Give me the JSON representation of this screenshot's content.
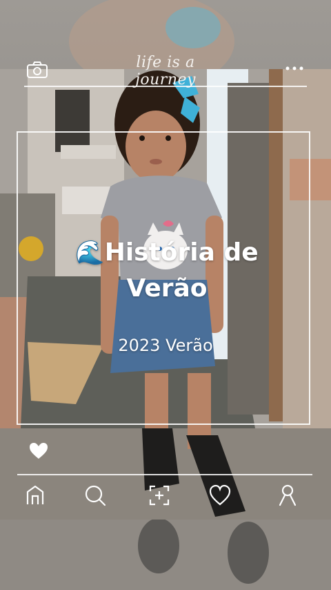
{
  "header": {
    "script_title": "life is a journey",
    "camera_icon": "camera-icon",
    "more_icon": "more-dots-icon"
  },
  "story": {
    "emoji": "🌊",
    "title": "História de Verão",
    "subtitle": "2023 Verão"
  },
  "nav": {
    "items": [
      "home-icon",
      "search-icon",
      "add-photo-icon",
      "heart-outline-icon",
      "profile-icon"
    ]
  },
  "colors": {
    "frame_white": "#ffffff",
    "wall": "#b8b2ab",
    "floor": "#5a5c55"
  }
}
